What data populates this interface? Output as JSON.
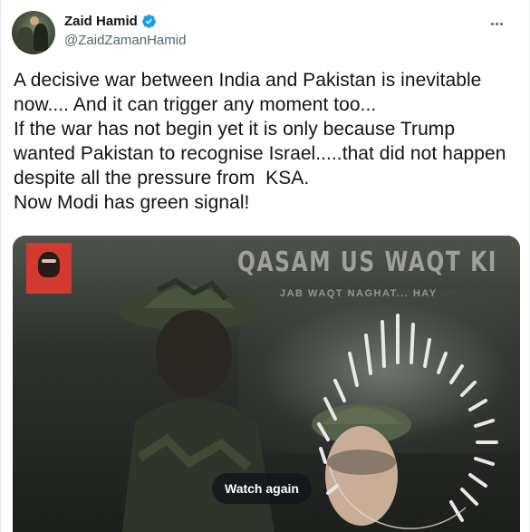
{
  "author": {
    "display_name": "Zaid Hamid",
    "handle": "@ZaidZamanHamid",
    "verified": true
  },
  "tweet": {
    "text": "A decisive war between India and Pakistan is inevitable now.... And it can trigger any moment too...\nIf the war has not begin yet it is only because Trump wanted Pakistan to recognise Israel.....that did not happen despite all the pressure from  KSA.\nNow Modi has green signal!"
  },
  "media": {
    "overlay_title": "QASAM US WAQT KI",
    "overlay_subtitle": "JAB WAQT NAGHAT... HAY",
    "button_label": "Watch again"
  },
  "icons": {
    "verified": "verified-badge-icon",
    "more": "more-options-icon"
  },
  "colors": {
    "verified_blue": "#1d9bf0",
    "text_primary": "#0f1419",
    "text_secondary": "#536471"
  }
}
